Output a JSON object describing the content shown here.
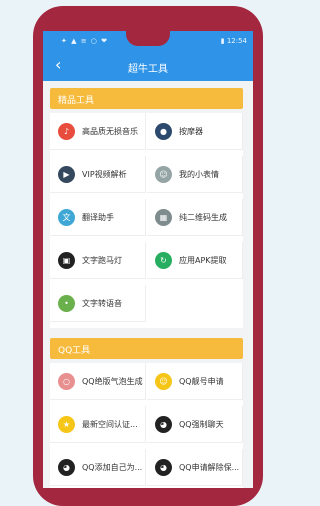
{
  "status": {
    "left": "✦ ▲ ≡ ○ ❤",
    "right": "▮ 12:54"
  },
  "header": {
    "back": "‹",
    "title": "超牛工具"
  },
  "sections": [
    {
      "title": "精品工具",
      "items": [
        {
          "label": "高品质无损音乐",
          "icon": "music-note-icon",
          "color": "#e74c3c"
        },
        {
          "label": "按摩器",
          "icon": "massager-icon",
          "color": "#2c4a6e"
        },
        {
          "label": "VIP视频解析",
          "icon": "video-play-icon",
          "color": "#34495e"
        },
        {
          "label": "我的小表情",
          "icon": "sticker-face-icon",
          "color": "#95a5a6"
        },
        {
          "label": "翻译助手",
          "icon": "translate-icon",
          "color": "#3fa7d6"
        },
        {
          "label": "纯二维码生成",
          "icon": "qr-code-icon",
          "color": "#7f8c8d"
        },
        {
          "label": "文字跑马灯",
          "icon": "marquee-text-icon",
          "color": "#222222"
        },
        {
          "label": "应用APK提取",
          "icon": "apk-extract-icon",
          "color": "#27ae60"
        },
        {
          "label": "文字转语音",
          "icon": "microphone-icon",
          "color": "#6ab04c"
        }
      ]
    },
    {
      "title": "QQ工具",
      "items": [
        {
          "label": "QQ绝版气泡生成",
          "icon": "bubble-icon",
          "color": "#e88f8f"
        },
        {
          "label": "QQ靓号申请",
          "icon": "smile-icon",
          "color": "#f5c518"
        },
        {
          "label": "最新空间认证...",
          "icon": "badge-icon",
          "color": "#f5c518"
        },
        {
          "label": "QQ强制聊天",
          "icon": "qq-penguin-icon",
          "color": "#222222"
        },
        {
          "label": "QQ添加自己为...",
          "icon": "qq-penguin-icon",
          "color": "#222222"
        },
        {
          "label": "QQ申请解除保...",
          "icon": "qq-penguin-icon",
          "color": "#222222"
        }
      ]
    }
  ]
}
